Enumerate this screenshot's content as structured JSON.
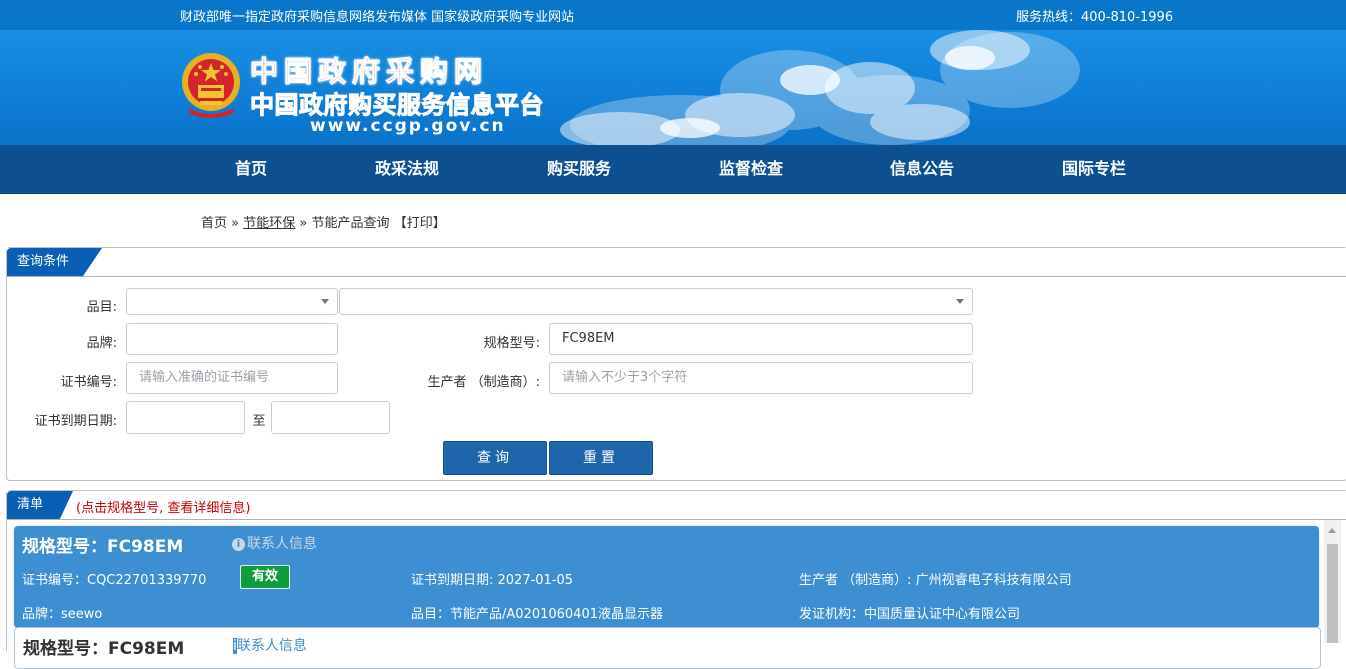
{
  "topbar": {
    "slogan": "财政部唯一指定政府采购信息网络发布媒体 国家级政府采购专业网站",
    "hotline": "服务热线：400-810-1996"
  },
  "logo": {
    "title": "中国政府采购网",
    "subtitle": "中国政府购买服务信息平台",
    "url": "www.ccgp.gov.cn"
  },
  "nav": {
    "items": [
      "首页",
      "政采法规",
      "购买服务",
      "监督检查",
      "信息公告",
      "国际专栏"
    ]
  },
  "breadcrumb": {
    "home": "首页",
    "sep1": "»",
    "section": "节能环保",
    "sep2": "»",
    "current": "节能产品查询",
    "print": "【打印】"
  },
  "query": {
    "tab": "查询条件",
    "category_label": "品目:",
    "category1_value": "",
    "category2_value": "",
    "brand_label": "品牌:",
    "brand_value": "",
    "model_label": "规格型号:",
    "model_value": "FC98EM",
    "cert_no_label": "证书编号:",
    "cert_no_placeholder": "请输入准确的证书编号",
    "maker_label": "生产者 （制造商）:",
    "maker_placeholder": "请输入不少于3个字符",
    "expiry_label": "证书到期日期:",
    "expiry_from": "",
    "to_label": "至",
    "expiry_to": "",
    "search_button": "查询",
    "reset_button": "重置"
  },
  "list": {
    "tab": "清单",
    "hint": "(点击规格型号, 查看详细信息)",
    "results": [
      {
        "model": "规格型号：FC98EM",
        "contact": "联系人信息",
        "cert_no": "证书编号：CQC22701339770",
        "status": "有效",
        "expiry": "证书到期日期: 2027-01-05",
        "maker": "生产者 （制造商）: 广州视睿电子科技有限公司",
        "brand": "品牌：seewo",
        "category": "品目：节能产品/A0201060401液晶显示器",
        "issuer": "发证机构：中国质量认证中心有限公司"
      },
      {
        "model": "规格型号：FC98EM",
        "contact": "联系人信息"
      }
    ]
  },
  "colors": {
    "topbar": "#0a76c9",
    "nav": "#0d4f8f",
    "tab": "#0a5fb4",
    "card": "#3d8fd1",
    "button": "#1f65ab",
    "valid_badge": "#119b3f",
    "logo_red": "#c8102e"
  },
  "icons": {
    "emblem": "national-emblem-icon",
    "contact": "info-circle-icon",
    "dropdown": "chevron-down-icon"
  }
}
